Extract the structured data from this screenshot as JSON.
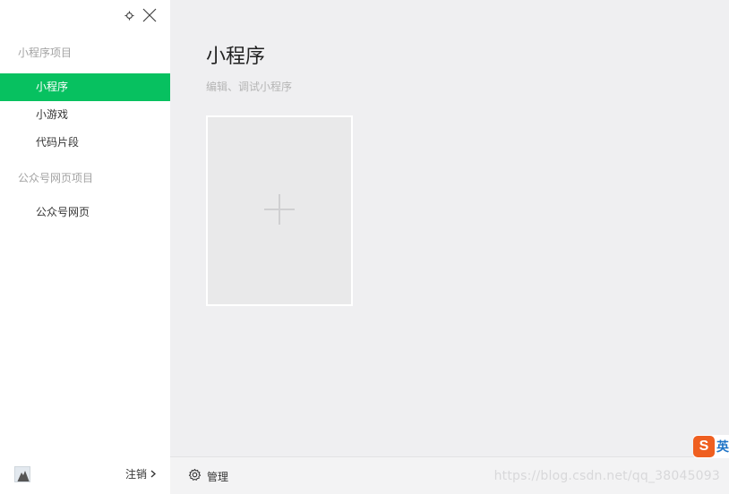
{
  "sidebar": {
    "sections": [
      {
        "title": "小程序项目",
        "items": [
          {
            "label": "小程序",
            "active": true
          },
          {
            "label": "小游戏",
            "active": false
          },
          {
            "label": "代码片段",
            "active": false
          }
        ]
      },
      {
        "title": "公众号网页项目",
        "items": [
          {
            "label": "公众号网页",
            "active": false
          }
        ]
      }
    ],
    "footer": {
      "logout_label": "注销"
    }
  },
  "main": {
    "title": "小程序",
    "subtitle": "编辑、调试小程序",
    "footer": {
      "manage_label": "管理",
      "watermark": "https://blog.csdn.net/qq_38045093"
    }
  },
  "ime": {
    "label": "英"
  },
  "colors": {
    "accent": "#07c160",
    "ime": "#ef5f20"
  },
  "icons": [
    "settings-icon",
    "close-icon",
    "plus-icon",
    "gear-icon",
    "chevron-right-icon"
  ]
}
